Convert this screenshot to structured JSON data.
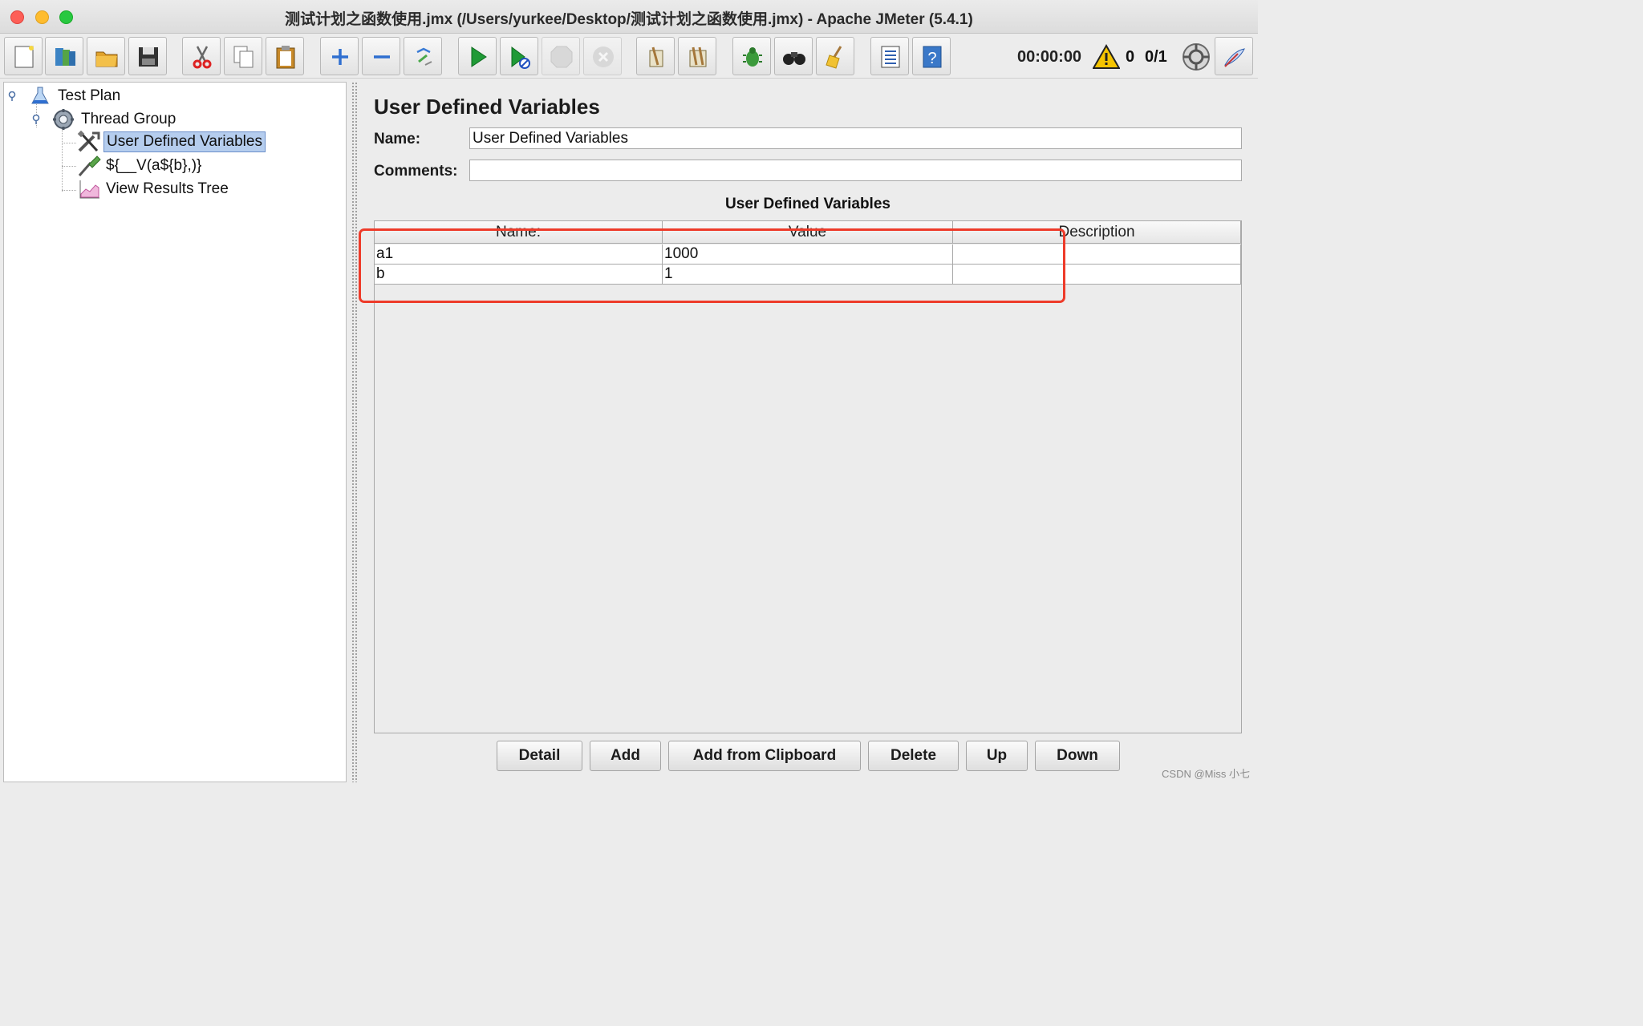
{
  "window": {
    "title": "测试计划之函数使用.jmx (/Users/yurkee/Desktop/测试计划之函数使用.jmx) - Apache JMeter (5.4.1)"
  },
  "toolbar": {
    "buttons": [
      "new-icon",
      "templates-icon",
      "open-icon",
      "save-icon",
      "cut-icon",
      "copy-icon",
      "paste-icon",
      "expand-icon",
      "collapse-icon",
      "toggle-icon",
      "start-icon",
      "start-no-pauses-icon",
      "stop-icon",
      "shutdown-icon",
      "clear-icon",
      "clear-all-icon",
      "debug-icon",
      "search-icon",
      "reset-search-icon",
      "function-helper-icon",
      "help-icon"
    ],
    "timer": "00:00:00",
    "warning_count": "0",
    "threads": "0/1"
  },
  "tree": {
    "items": [
      {
        "label": "Test Plan",
        "icon": "test-plan-icon"
      },
      {
        "label": "Thread Group",
        "icon": "thread-group-icon"
      },
      {
        "label": "User Defined Variables",
        "icon": "tools-icon",
        "selected": true
      },
      {
        "label": "${__V(a${b},)}",
        "icon": "sampler-icon"
      },
      {
        "label": "View Results Tree",
        "icon": "chart-icon"
      }
    ]
  },
  "panel": {
    "title": "User Defined Variables",
    "name_label": "Name:",
    "name_value": "User Defined Variables",
    "comments_label": "Comments:",
    "comments_value": "",
    "table_caption": "User Defined Variables",
    "columns": [
      "Name:",
      "Value",
      "Description"
    ],
    "rows": [
      {
        "name": "a1",
        "value": "1000",
        "description": ""
      },
      {
        "name": "b",
        "value": "1",
        "description": ""
      }
    ]
  },
  "buttons": {
    "detail": "Detail",
    "add": "Add",
    "add_clipboard": "Add from Clipboard",
    "delete": "Delete",
    "up": "Up",
    "down": "Down"
  },
  "annotation_color": "#ee3b2a",
  "watermark": "CSDN @Miss 小七"
}
